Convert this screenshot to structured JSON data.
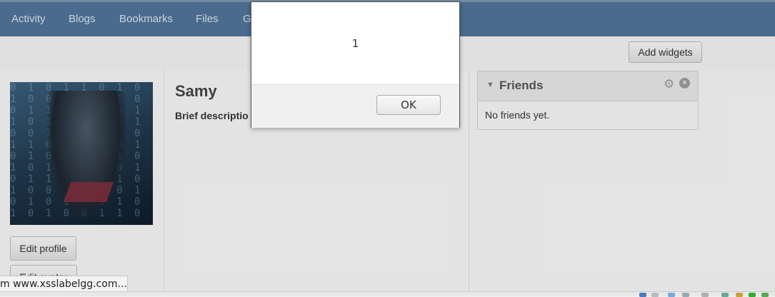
{
  "nav": {
    "items": [
      {
        "label": "Activity"
      },
      {
        "label": "Blogs"
      },
      {
        "label": "Bookmarks"
      },
      {
        "label": "Files"
      },
      {
        "label": "G"
      }
    ]
  },
  "toolbar": {
    "add_widgets_label": "Add widgets"
  },
  "profile": {
    "name": "Samy",
    "brief_label": "Brief descriptio",
    "edit_profile_label": "Edit profile",
    "edit_avatar_label": "Edit avatar"
  },
  "friends_widget": {
    "title": "Friends",
    "empty_text": "No friends yet."
  },
  "alert": {
    "message": "1",
    "ok_label": "OK"
  },
  "status": {
    "text": "m www.xsslabelgg.com..."
  },
  "colors": {
    "nav_bg": "#4f7296",
    "page_bg": "#f2f2f2"
  }
}
